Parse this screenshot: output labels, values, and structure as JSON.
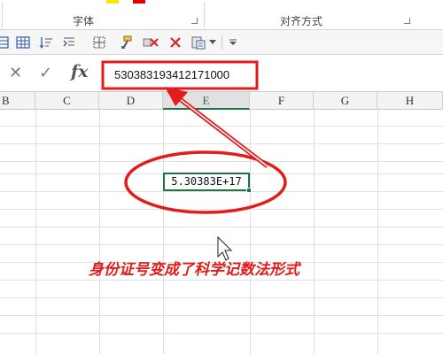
{
  "ribbon": {
    "groups": [
      {
        "label": "字体"
      },
      {
        "label": "对齐方式"
      }
    ]
  },
  "toolbar": {
    "buttons": [
      "table-icon",
      "sort-icon",
      "indent-icon",
      "border-icon",
      "format-painter-icon",
      "clear-format-icon",
      "delete-icon",
      "paste-special-icon",
      "dropdown-arrow-icon",
      "customize-icon"
    ]
  },
  "formula_bar": {
    "cancel_glyph": "✕",
    "enter_glyph": "✓",
    "fx_label": "fx",
    "value": "530383193412171000"
  },
  "columns": [
    {
      "label": "B"
    },
    {
      "label": "C"
    },
    {
      "label": "D"
    },
    {
      "label": "E",
      "selected": true
    },
    {
      "label": "F"
    },
    {
      "label": "G"
    },
    {
      "label": "H"
    }
  ],
  "active_cell": {
    "display": "5.30383E+17"
  },
  "annotation": {
    "text": "身份证号变成了科学记数法形式",
    "color": "#e31b1b"
  },
  "colors": {
    "excel_green": "#217346",
    "annotation_red": "#e31b1b"
  }
}
